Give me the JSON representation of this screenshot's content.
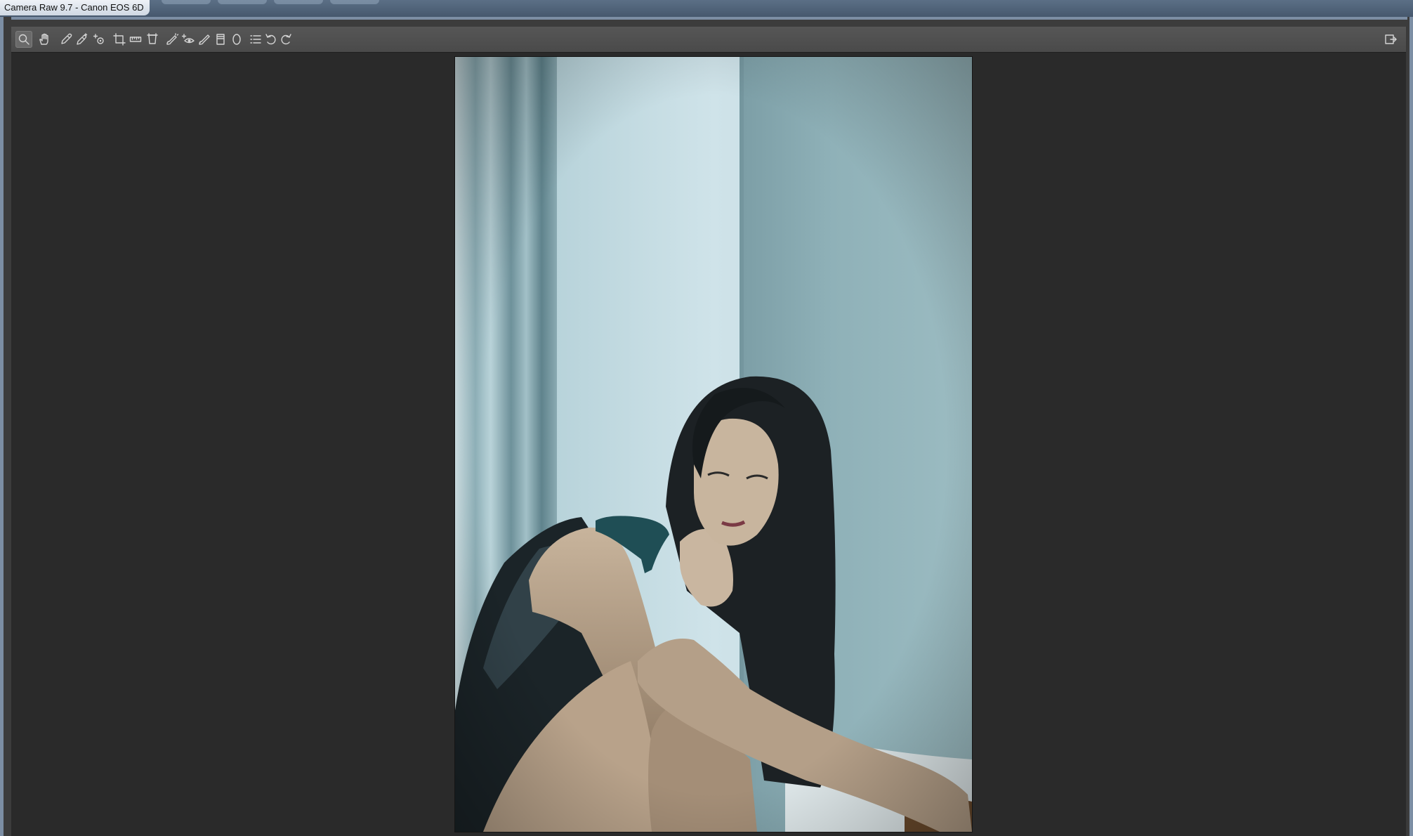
{
  "window": {
    "title": "Camera Raw 9.7 -  Canon EOS 6D"
  },
  "toolbar": {
    "tools": [
      {
        "name": "zoom-tool",
        "icon": "magnifier-icon",
        "active": true
      },
      {
        "name": "hand-tool",
        "icon": "hand-icon",
        "active": false
      },
      {
        "name": "white-balance-tool",
        "icon": "eyedropper-icon",
        "active": false
      },
      {
        "name": "color-sampler-tool",
        "icon": "eyedropper-plus-icon",
        "active": false
      },
      {
        "name": "targeted-adjustment-tool",
        "icon": "target-adjust-icon",
        "active": false
      },
      {
        "name": "crop-tool",
        "icon": "crop-icon",
        "active": false
      },
      {
        "name": "straighten-tool",
        "icon": "ruler-icon",
        "active": false
      },
      {
        "name": "transform-tool",
        "icon": "transform-icon",
        "active": false
      },
      {
        "name": "spot-removal-tool",
        "icon": "spot-brush-icon",
        "active": false
      },
      {
        "name": "red-eye-tool",
        "icon": "red-eye-icon",
        "active": false
      },
      {
        "name": "adjustment-brush-tool",
        "icon": "brush-icon",
        "active": false
      },
      {
        "name": "graduated-filter-tool",
        "icon": "graduated-filter-icon",
        "active": false
      },
      {
        "name": "radial-filter-tool",
        "icon": "ellipse-icon",
        "active": false
      },
      {
        "name": "preferences-tool",
        "icon": "list-icon",
        "active": false
      },
      {
        "name": "rotate-left-tool",
        "icon": "rotate-ccw-icon",
        "active": false
      },
      {
        "name": "rotate-right-tool",
        "icon": "rotate-cw-icon",
        "active": false
      }
    ],
    "fullscreen_icon": "fullscreen-toggle-icon"
  },
  "preview": {
    "image": "portrait-photo"
  },
  "colors": {
    "canvas": "#2a2a2a",
    "toolbar": "#4f4f4f",
    "titlebar": "#51647a"
  }
}
